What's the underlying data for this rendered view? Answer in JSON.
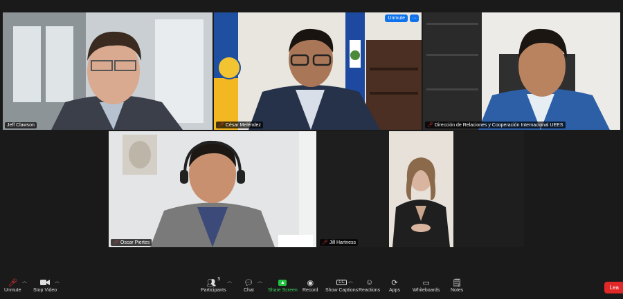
{
  "participants": [
    {
      "name": "Jeff Clawson",
      "muted": false,
      "active_speaker": true
    },
    {
      "name": "César Meléndez",
      "muted": true,
      "active_speaker": false
    },
    {
      "name": "Dirección de Relaciones y Cooperación Internacional UEES",
      "muted": true,
      "active_speaker": false
    },
    {
      "name": "Oscar Piertes",
      "muted": true,
      "active_speaker": false
    },
    {
      "name": "Jill Hartness",
      "muted": true,
      "active_speaker": false
    }
  ],
  "tile_controls": {
    "unmute_label": "Unmute",
    "more_label": "···"
  },
  "toolbar": {
    "unmute": {
      "label": "Unmute",
      "icon": "mic-muted-icon"
    },
    "stop_video": {
      "label": "Stop Video",
      "icon": "video-camera-icon"
    },
    "participants": {
      "label": "Participants",
      "count": "5",
      "icon": "participants-icon"
    },
    "chat": {
      "label": "Chat",
      "icon": "chat-icon"
    },
    "share_screen": {
      "label": "Share Screen",
      "icon": "share-screen-icon"
    },
    "record": {
      "label": "Record",
      "icon": "record-icon"
    },
    "show_captions": {
      "label": "Show Captions",
      "icon": "cc-icon",
      "badge": "CC"
    },
    "reactions": {
      "label": "Reactions",
      "icon": "reactions-icon"
    },
    "apps": {
      "label": "Apps",
      "icon": "apps-icon"
    },
    "whiteboards": {
      "label": "Whiteboards",
      "icon": "whiteboard-icon"
    },
    "notes": {
      "label": "Notes",
      "icon": "notes-icon"
    },
    "leave": {
      "label": "Lea"
    }
  },
  "colors": {
    "accent": "#0e72ed",
    "share_green": "#23c140",
    "leave_red": "#e02828",
    "active_border": "#c9e23a",
    "muted_red": "#e53935"
  }
}
